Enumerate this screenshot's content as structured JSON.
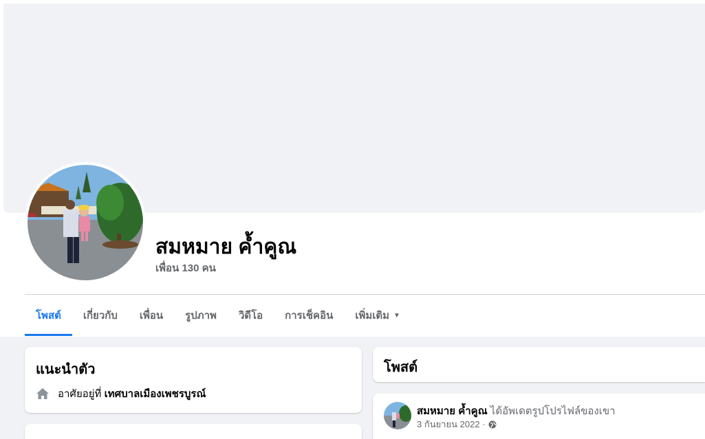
{
  "profile": {
    "name": "สมหมาย ค้ำคูณ",
    "friends": "เพื่อน 130 คน"
  },
  "tabs": [
    {
      "label": "โพสต์",
      "active": true
    },
    {
      "label": "เกี่ยวกับ",
      "active": false
    },
    {
      "label": "เพื่อน",
      "active": false
    },
    {
      "label": "รูปภาพ",
      "active": false
    },
    {
      "label": "วิดีโอ",
      "active": false
    },
    {
      "label": "การเช็คอิน",
      "active": false
    },
    {
      "label": "เพิ่มเติม",
      "active": false
    }
  ],
  "intro": {
    "title": "แนะนำตัว",
    "lives_in_prefix": "อาศัยอยู่ที่",
    "lives_in_place": "เทศบาลเมืองเพชรบูรณ์",
    "icon": "home-icon"
  },
  "posts": {
    "title": "โพสต์",
    "first": {
      "author": "สมหมาย ค้ำคูณ",
      "action": "ได้อัพเดตรูปโปรไฟล์ของเขา",
      "date": "3 กันยายน 2022",
      "separator": "·",
      "privacy_icon": "globe-icon"
    }
  },
  "colors": {
    "accent": "#1877f2",
    "page_bg": "#f0f2f5",
    "secondary_text": "#65676b"
  }
}
